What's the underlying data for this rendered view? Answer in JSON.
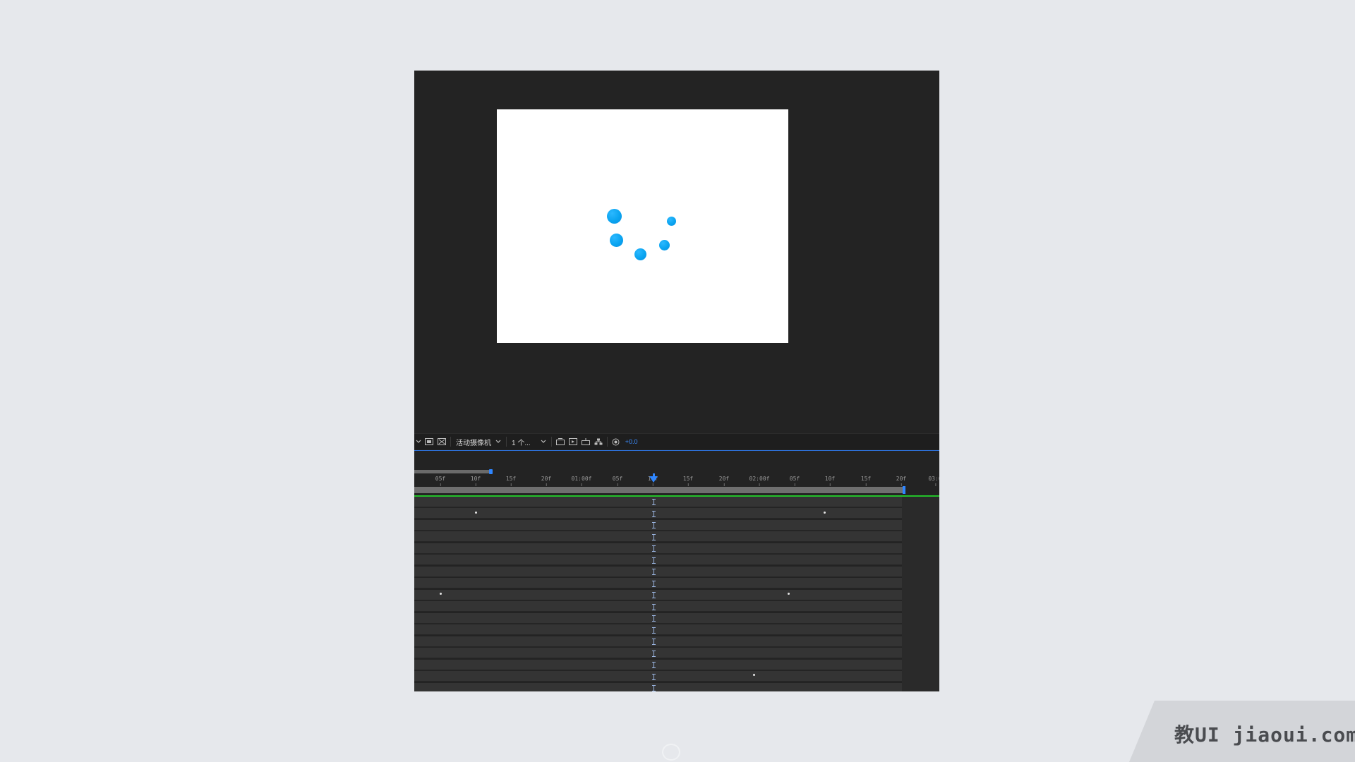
{
  "viewer": {
    "dots": [
      {
        "id": "dot-1",
        "color": "#0aa4f0"
      },
      {
        "id": "dot-2",
        "color": "#0aa4f0"
      },
      {
        "id": "dot-3",
        "color": "#0aa4f0"
      },
      {
        "id": "dot-4",
        "color": "#0aa4f0"
      },
      {
        "id": "dot-5",
        "color": "#0aa4f0"
      }
    ]
  },
  "toolbar": {
    "camera_label": "活动摄像机",
    "view_label": "1 个...",
    "exposure_value": "+0.0"
  },
  "timeline": {
    "ruler_ticks": [
      "05f",
      "10f",
      "15f",
      "20f",
      "01:00f",
      "05f",
      "10f",
      "15f",
      "20f",
      "02:00f",
      "05f",
      "10f",
      "15f",
      "20f",
      "03:0"
    ],
    "current_time_label": "10f",
    "row_count": 16
  },
  "watermark": {
    "text": "教UI jiaoui.com"
  },
  "colors": {
    "accent_blue": "#2f86ff",
    "work_area_green": "#23c12a",
    "dot_blue": "#0aa4f0"
  }
}
